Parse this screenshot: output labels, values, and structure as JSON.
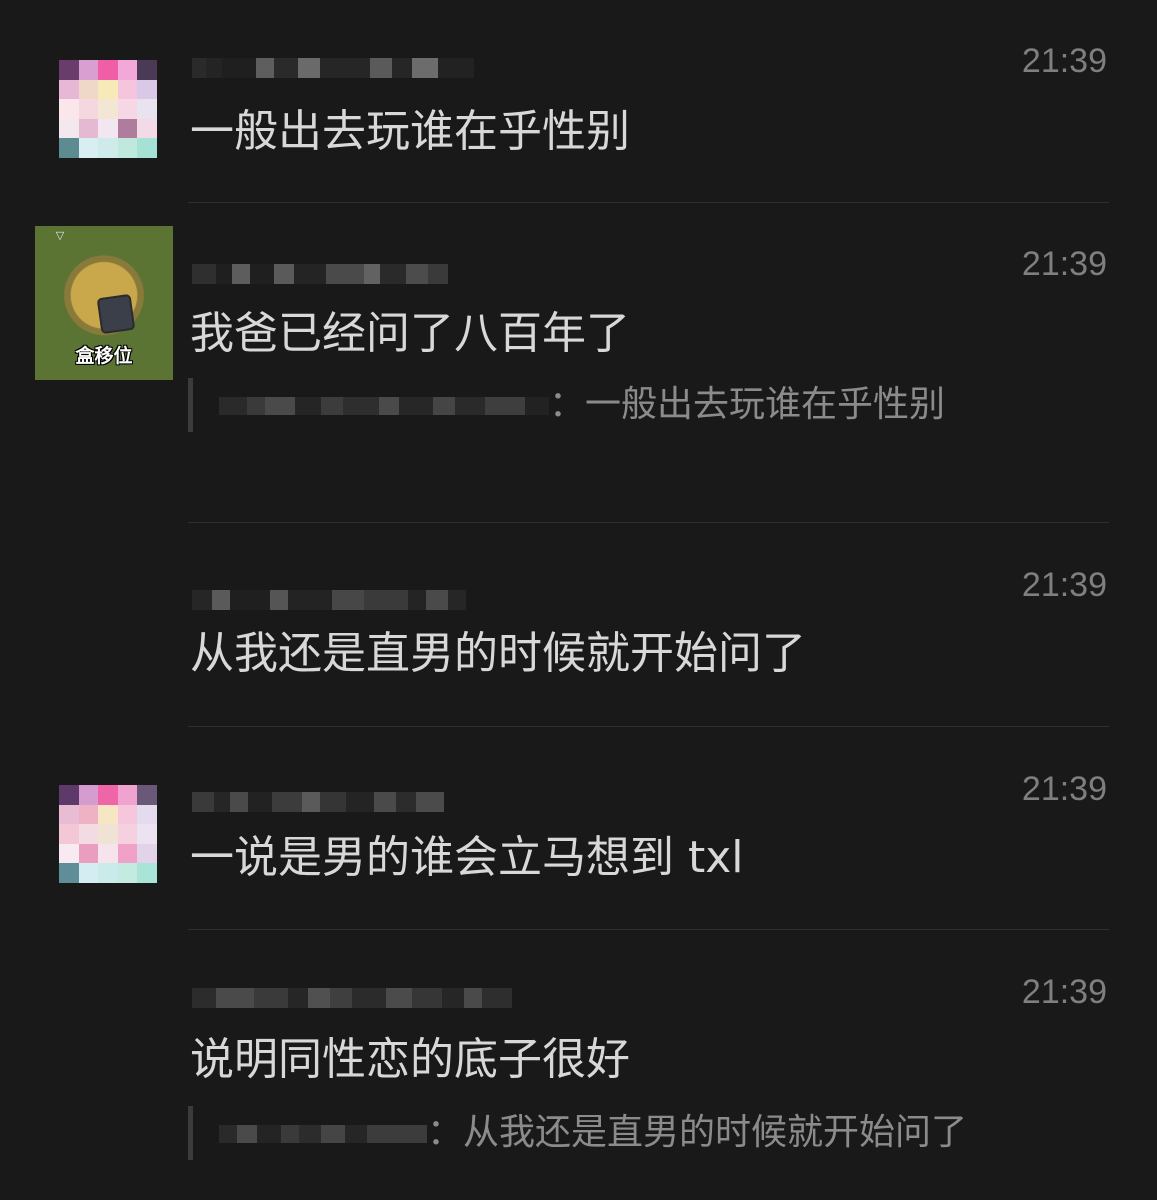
{
  "messages": [
    {
      "time": "21:39",
      "text": "一般出去玩谁在乎性别",
      "avatar_icon": "pixelated-avatar"
    },
    {
      "time": "21:39",
      "text": "我爸已经问了八百年了",
      "avatar_icon": "game-avatar",
      "avatar_caption": "盒移位",
      "quote": {
        "separator": "：",
        "text": "一般出去玩谁在乎性别"
      }
    },
    {
      "time": "21:39",
      "text": "从我还是直男的时候就开始问了"
    },
    {
      "time": "21:39",
      "text": "一说是男的谁会立马想到 txl",
      "avatar_icon": "pixelated-avatar"
    },
    {
      "time": "21:39",
      "text": "说明同性恋的底子很好",
      "quote": {
        "separator": "：",
        "text": "从我还是直男的时候就开始问了"
      }
    }
  ],
  "colors": {
    "background": "#191919",
    "message_text": "#d8d8d8",
    "timestamp": "#7f7f7f",
    "quote_text": "#8b8b8b"
  }
}
